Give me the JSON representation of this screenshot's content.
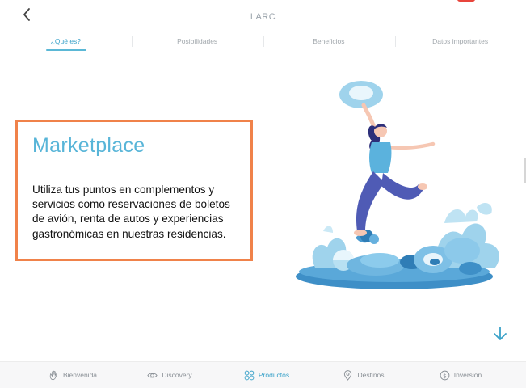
{
  "header": {
    "title": "LARC",
    "back_icon": "chevron-left-icon"
  },
  "tabs": [
    {
      "label": "¿Qué es?",
      "active": true
    },
    {
      "label": "Posibilidades",
      "active": false
    },
    {
      "label": "Beneficios",
      "active": false
    },
    {
      "label": "Datos importantes",
      "active": false
    }
  ],
  "card": {
    "title": "Marketplace",
    "body": "Utiliza tus puntos en complementos y servicios como reservaciones de boletos de avión, renta de autos y experiencias gastronómicas en nuestras residencias.",
    "border_color": "#f0824a",
    "title_color": "#58b5d8"
  },
  "scroll_down_icon": "arrow-down-icon",
  "bottom_nav": [
    {
      "label": "Bienvenida",
      "icon": "wave-hand-icon",
      "active": false
    },
    {
      "label": "Discovery",
      "icon": "eye-icon",
      "active": false
    },
    {
      "label": "Productos",
      "icon": "grid-circles-icon",
      "active": true
    },
    {
      "label": "Destinos",
      "icon": "location-pin-icon",
      "active": false
    },
    {
      "label": "Inversión",
      "icon": "dollar-coin-icon",
      "active": false
    }
  ],
  "colors": {
    "accent": "#3aa2c9",
    "inactive_text": "#8a9096"
  }
}
